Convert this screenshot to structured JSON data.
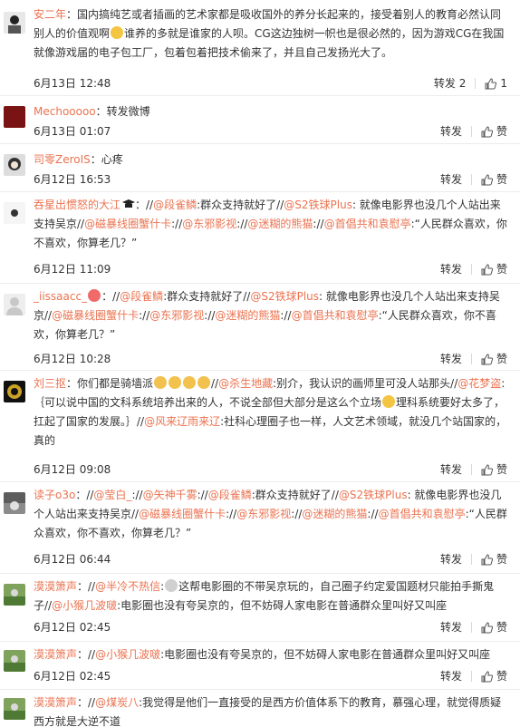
{
  "actions": {
    "repost": "转发",
    "like": "赞"
  },
  "comments": [
    {
      "username": "安二年",
      "parts": [
        "：国内搞纯艺或者插画的艺术家都是吸收国外的养分长起来的，接受着别人的教育必然认同别人的价值观啊",
        "谁养的多就是谁家的人呗。CG这边独树一帜也是很必然的，因为游戏CG在我国就像游戏届的电子包工厂，包着包着把技术偷来了，并且自己发扬光大了。"
      ],
      "time": "6月13日 12:48",
      "repost": "转发 2",
      "like": "1"
    },
    {
      "username": "Mechooooo",
      "parts": [
        "：转发微博"
      ],
      "time": "6月13日 01:07"
    },
    {
      "username": "司零ZeroIS",
      "parts": [
        "：心疼"
      ],
      "time": "6月12日 16:53"
    },
    {
      "username": "吞星出惯怒的大江",
      "parts": [
        "：//",
        "@段雀鳞",
        ":群众支持就好了//",
        "@S2铁球Plus",
        ": 就像电影界也没几个人站出来支持吴京//",
        "@磁暴线圈蟹什卡",
        ":",
        "//",
        "@东邪影视",
        ":",
        "//",
        "@迷糊的熊猫",
        ":",
        "//",
        "@首倡共和袁慰亭",
        ":“人民群众喜欢，你不喜欢，你算老几？”"
      ],
      "time": "6月12日 11:09"
    },
    {
      "username": "_iissaacc_",
      "parts": [
        "：//",
        "@段雀鳞",
        ":群众支持就好了//",
        "@S2铁球Plus",
        ": 就像电影界也没几个人站出来支持吴京//",
        "@磁暴线圈蟹什卡",
        ":",
        "//",
        "@东邪影视",
        ":",
        "//",
        "@迷糊的熊猫",
        ":",
        "//",
        "@首倡共和袁慰亭",
        ":“人民群众喜欢，你不喜欢，你算老几？”"
      ],
      "time": "6月12日 10:28"
    },
    {
      "username": "刘三抠",
      "parts": [
        "：你们都是骑墙派",
        "//",
        "@杀生地藏",
        ":别介，我认识的画师里可没人站那头//",
        "@花梦盗",
        ":｛可以说中国的文科系统培养出来的人，不说全部但大部分是这么个立场",
        "理科系统要好太多了，扛起了国家的发展。｝//",
        "@风来辽雨来辽",
        ":社科心理圈子也一样，人文艺术领域，就没几个站国家的，真的"
      ],
      "time": "6月12日 09:08"
    },
    {
      "username": "读子o3o",
      "parts": [
        "：//",
        "@莹白_",
        ":",
        "//",
        "@矢神千雾",
        ":",
        "//",
        "@段雀鳞",
        ":群众支持就好了//",
        "@S2铁球Plus",
        ": 就像电影界也没几个人站出来支持吴京//",
        "@磁暴线圈蟹什卡",
        ":",
        "//",
        "@东邪影视",
        ":",
        "//",
        "@迷糊的熊猫",
        ":",
        "//",
        "@首倡共和袁慰亭",
        ":“人民群众喜欢，你不喜欢，你算老几？”"
      ],
      "time": "6月12日 06:44"
    },
    {
      "username": "漠漠箫声",
      "parts": [
        "：//",
        "@半冷不热信",
        ":",
        "这帮电影圈的不带吴京玩的，自己圈子约定爱国题材只能拍手撕鬼子//",
        "@小猴几波啵",
        ":电影圈也没有夸吴京的，但不妨碍人家电影在普通群众里叫好又叫座"
      ],
      "time": "6月12日 02:45"
    },
    {
      "username": "漠漠箫声",
      "parts": [
        "：//",
        "@小猴几波啵",
        ":电影圈也没有夸吴京的，但不妨碍人家电影在普通群众里叫好又叫座"
      ],
      "time": "6月12日 02:45"
    },
    {
      "username": "漠漠箫声",
      "parts": [
        "：//",
        "@煤炭八",
        ":我觉得是他们一直接受的是西方价值体系下的教育，慕强心理，就觉得质疑西方就是大逆不道"
      ]
    }
  ]
}
